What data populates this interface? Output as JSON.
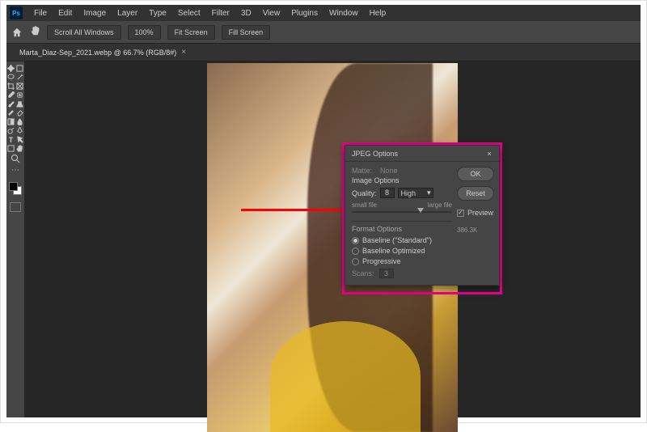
{
  "menu": [
    "File",
    "Edit",
    "Image",
    "Layer",
    "Type",
    "Select",
    "Filter",
    "3D",
    "View",
    "Plugins",
    "Window",
    "Help"
  ],
  "optionbar": {
    "opt1": "Scroll All Windows",
    "opt2": "100%",
    "opt3": "Fit Screen",
    "opt4": "Fill Screen"
  },
  "doc_tab": "Marta_Diaz-Sep_2021.webp @ 66.7% (RGB/8#)",
  "dialog": {
    "title": "JPEG Options",
    "matte_label": "Matte:",
    "matte_value": "None",
    "section_image": "Image Options",
    "quality_label": "Quality:",
    "quality_value": "8",
    "quality_preset": "High",
    "slider_small": "small file",
    "slider_large": "large file",
    "section_format": "Format Options",
    "radio_baseline_std": "Baseline (\"Standard\")",
    "radio_baseline_opt": "Baseline Optimized",
    "radio_progressive": "Progressive",
    "scans_label": "Scans:",
    "scans_value": "3",
    "ok": "OK",
    "reset": "Reset",
    "preview_label": "Preview",
    "filesize": "386.3K"
  }
}
